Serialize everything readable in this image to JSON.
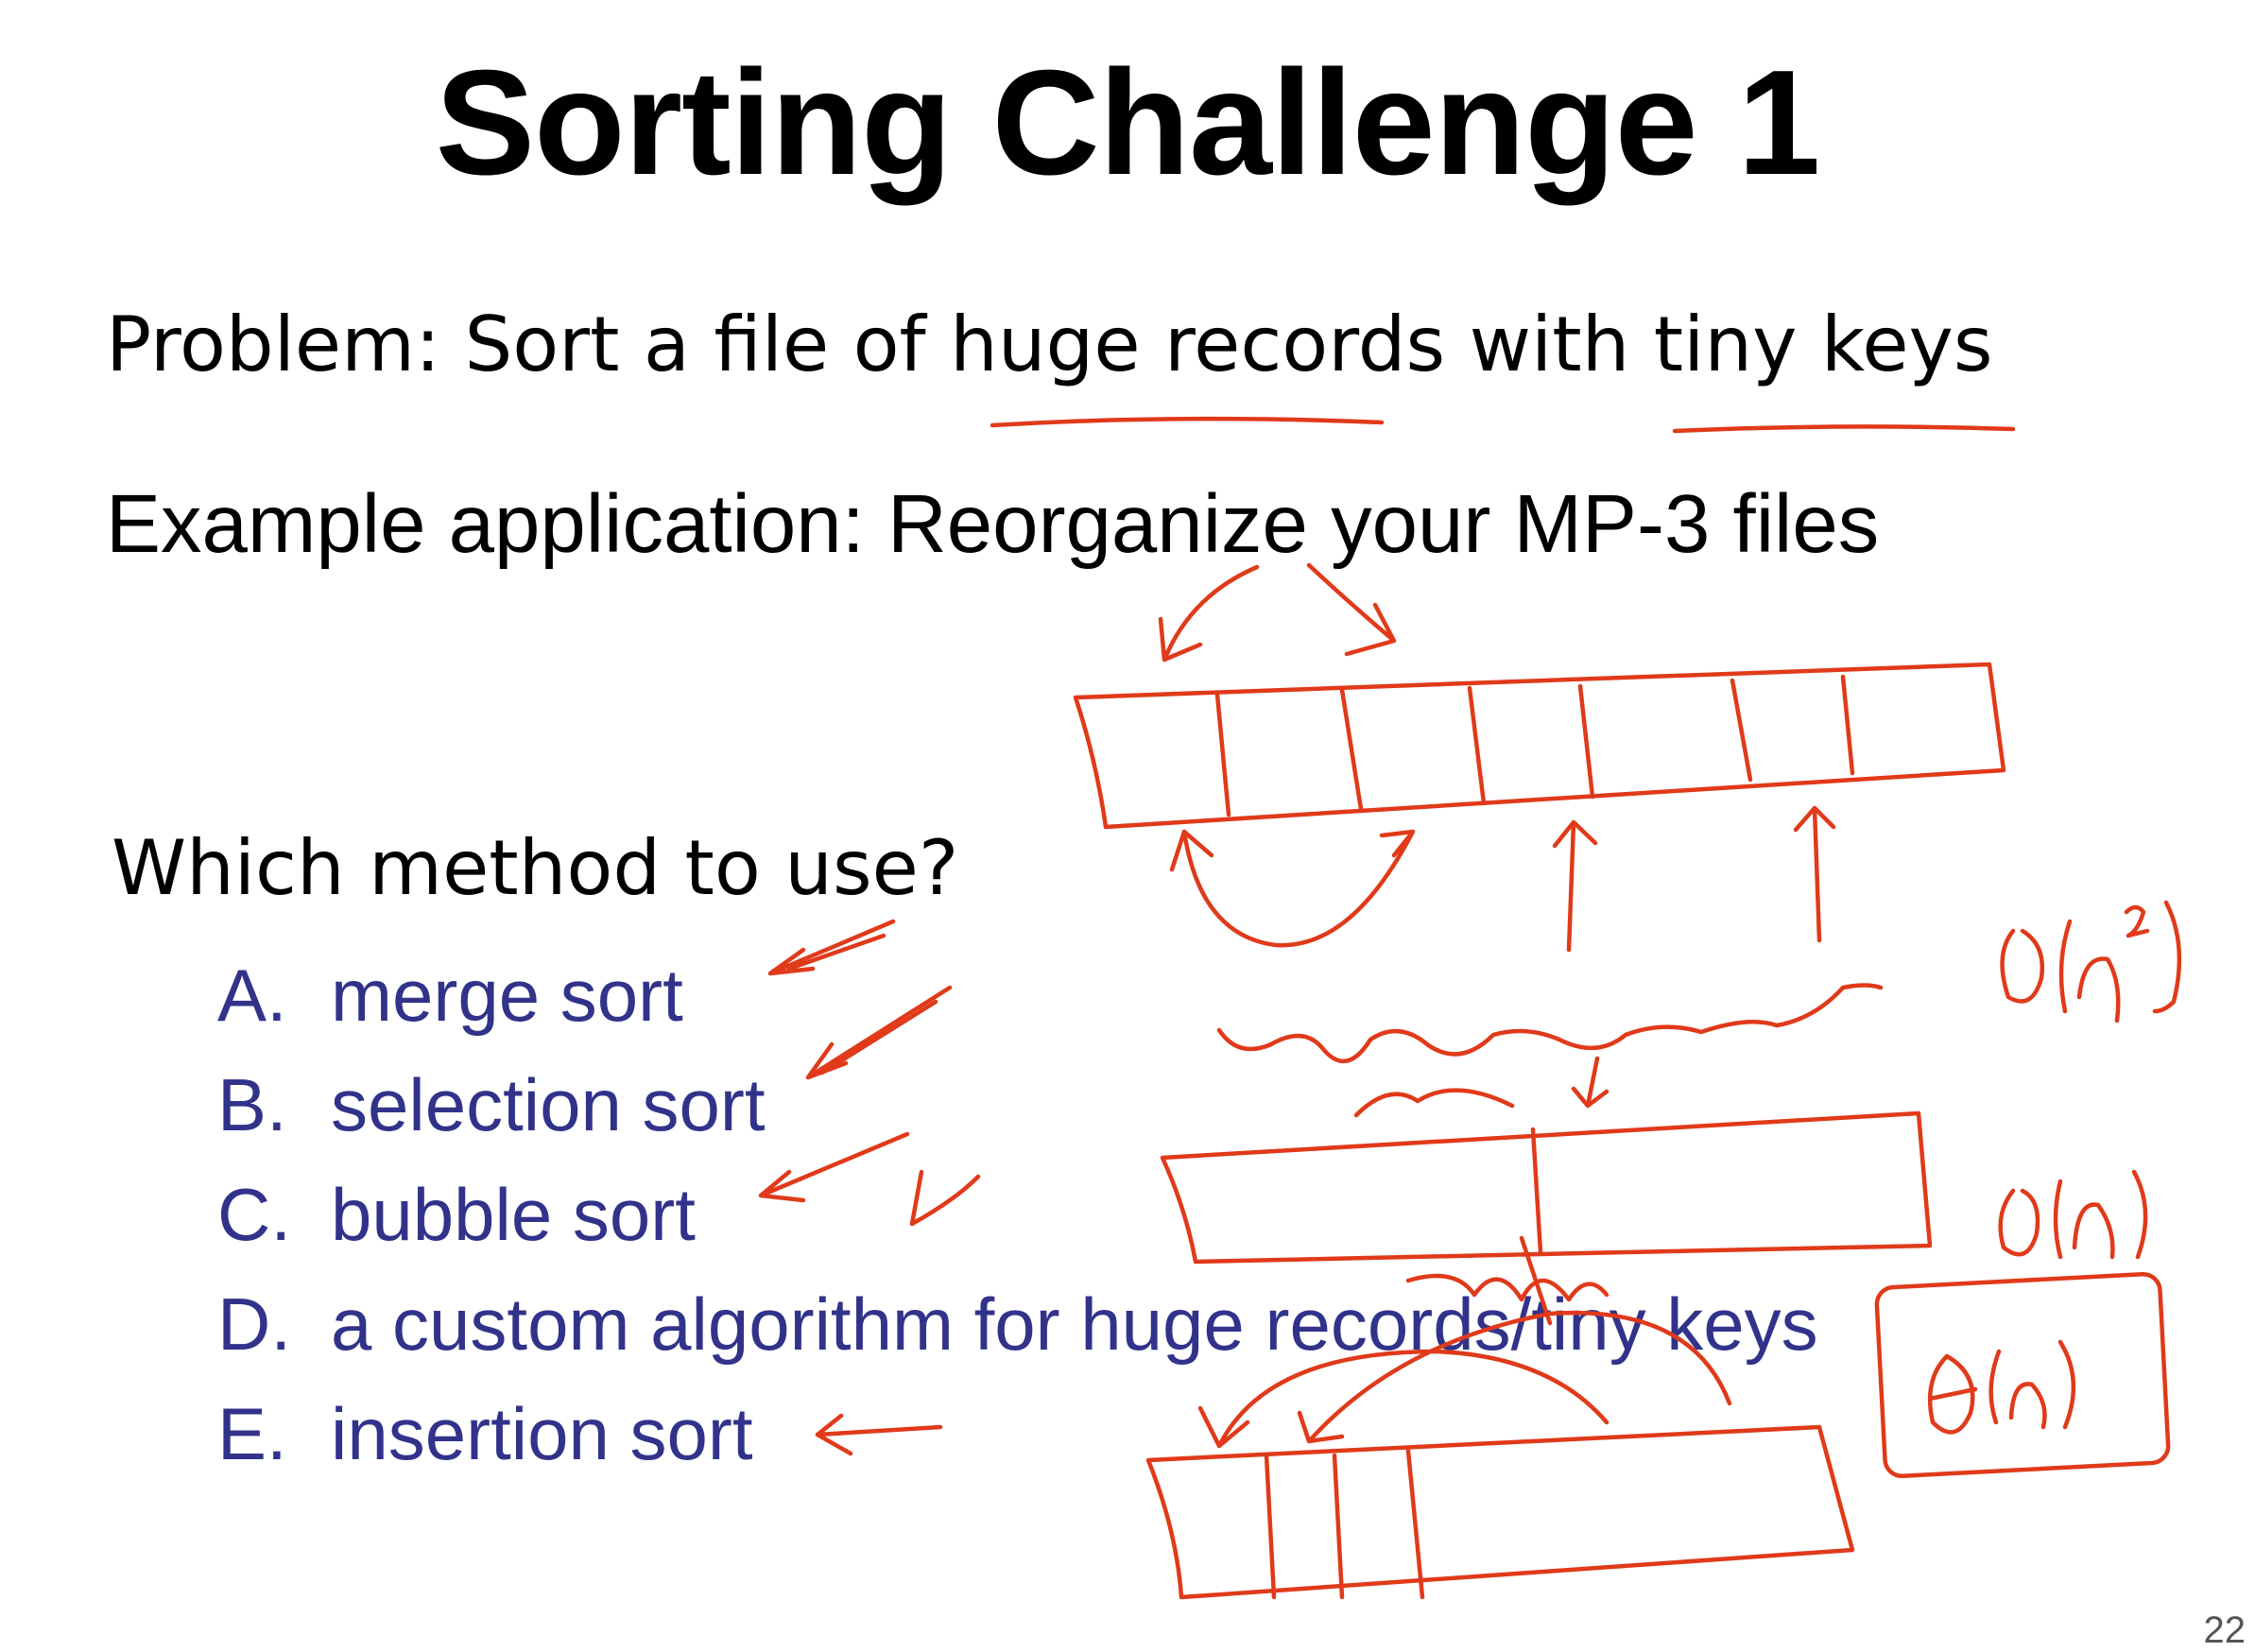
{
  "slide": {
    "title": "Sorting Challenge 1",
    "problem": "Problem: Sort a file of huge records with tiny keys",
    "example": "Example application: Reorganize your MP-3 files",
    "question": "Which method to use?",
    "options": [
      {
        "letter": "A.",
        "text": "merge sort"
      },
      {
        "letter": "B.",
        "text": "selection sort"
      },
      {
        "letter": "C.",
        "text": "bubble sort"
      },
      {
        "letter": "D.",
        "text": "a custom algorithm for huge records/tiny keys"
      },
      {
        "letter": "E.",
        "text": "insertion sort"
      }
    ],
    "page_number": "22"
  },
  "annotations": {
    "ink_color": "#e03a1a",
    "complexity_notes": [
      "O(n²)",
      "O(n)",
      "Θ(n)"
    ]
  }
}
